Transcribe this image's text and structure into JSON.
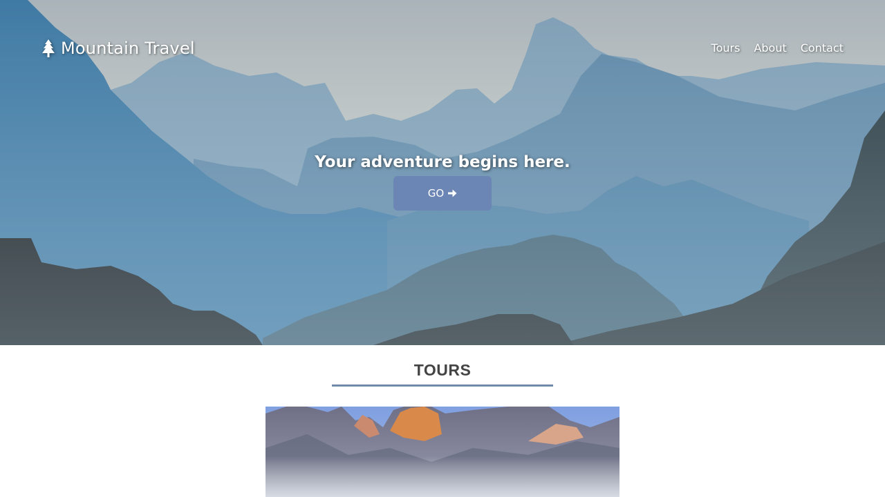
{
  "brand": {
    "name": "Mountain Travel",
    "icon": "tree-icon"
  },
  "nav": {
    "items": [
      {
        "label": "Tours"
      },
      {
        "label": "About"
      },
      {
        "label": "Contact"
      }
    ]
  },
  "hero": {
    "tagline": "Your adventure begins here.",
    "button_label": "GO",
    "button_icon": "arrow-right-icon"
  },
  "tours": {
    "title": "TOURS"
  },
  "colors": {
    "accent": "#6b86b5",
    "underline": "#6e8aa6",
    "heading": "#444444",
    "background": "#ffffff"
  }
}
